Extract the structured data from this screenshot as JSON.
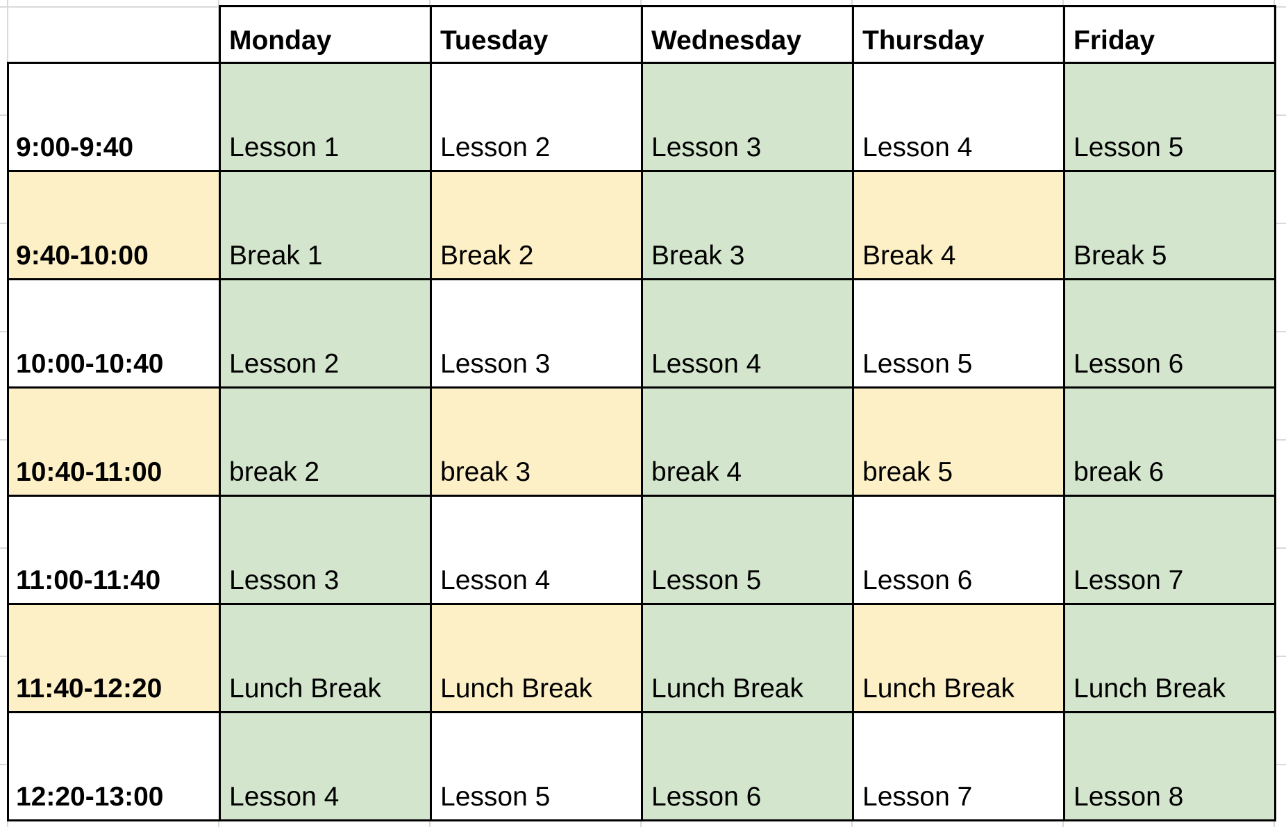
{
  "colors": {
    "lesson_fill": "#d3e5cc",
    "break_fill": "#fdf0c6",
    "plain_fill": "#ffffff",
    "border": "#000000",
    "gridline": "#d9d9d9"
  },
  "timetable": {
    "days": [
      "Monday",
      "Tuesday",
      "Wednesday",
      "Thursday",
      "Friday"
    ],
    "rows": [
      {
        "time": "9:00-9:40",
        "cells": [
          "Lesson 1",
          "Lesson 2",
          "Lesson 3",
          "Lesson 4",
          "Lesson 5"
        ]
      },
      {
        "time": "9:40-10:00",
        "cells": [
          "Break 1",
          "Break 2",
          "Break 3",
          "Break 4",
          "Break 5"
        ]
      },
      {
        "time": "10:00-10:40",
        "cells": [
          "Lesson 2",
          "Lesson 3",
          "Lesson 4",
          "Lesson 5",
          "Lesson 6"
        ]
      },
      {
        "time": "10:40-11:00",
        "cells": [
          "break 2",
          "break 3",
          "break 4",
          "break 5",
          "break 6"
        ]
      },
      {
        "time": "11:00-11:40",
        "cells": [
          "Lesson 3",
          "Lesson 4",
          "Lesson 5",
          "Lesson 6",
          "Lesson 7"
        ]
      },
      {
        "time": "11:40-12:20",
        "cells": [
          "Lunch Break",
          "Lunch Break",
          "Lunch Break",
          "Lunch Break",
          "Lunch Break"
        ]
      },
      {
        "time": "12:20-13:00",
        "cells": [
          "Lesson 4",
          "Lesson 5",
          "Lesson 6",
          "Lesson 7",
          "Lesson 8"
        ]
      }
    ]
  }
}
